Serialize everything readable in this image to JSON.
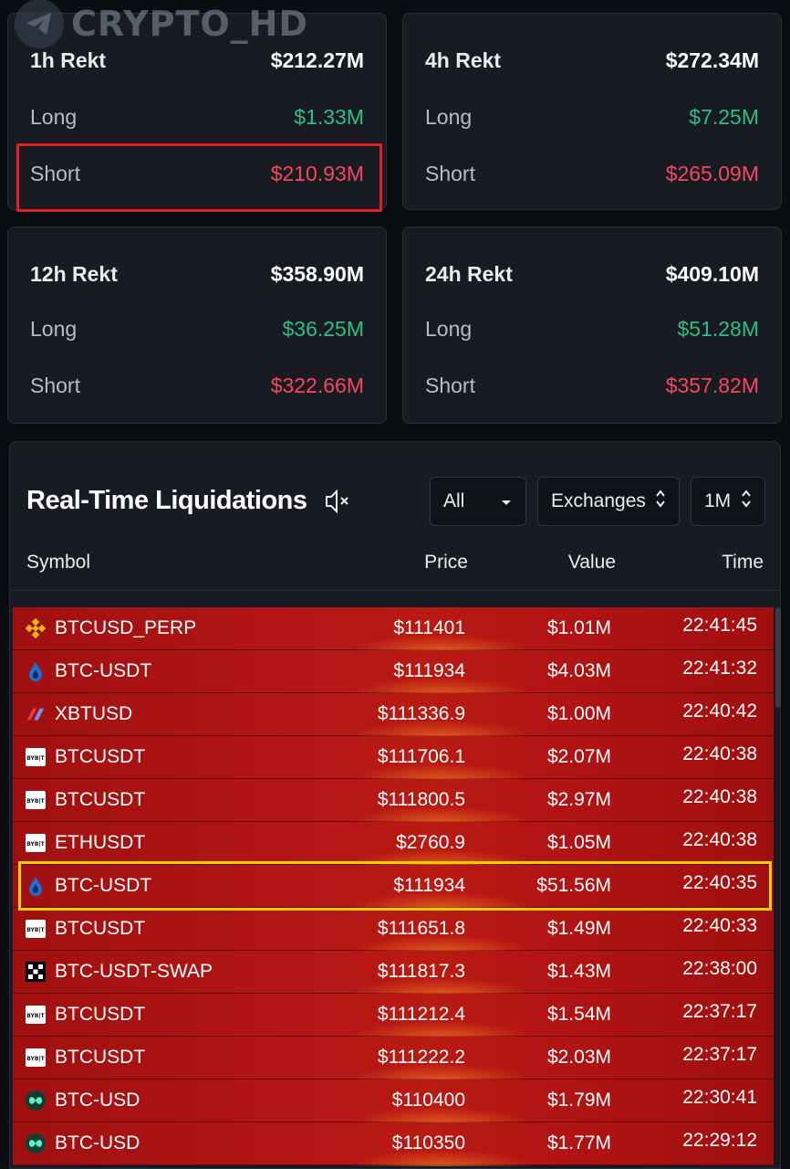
{
  "watermark": {
    "text": "CRYPTO_HD",
    "icon": "telegram-icon"
  },
  "cards": [
    {
      "title": "1h Rekt",
      "total": "$212.27M",
      "long_label": "Long",
      "long": "$1.33M",
      "short_label": "Short",
      "short": "$210.93M"
    },
    {
      "title": "4h Rekt",
      "total": "$272.34M",
      "long_label": "Long",
      "long": "$7.25M",
      "short_label": "Short",
      "short": "$265.09M"
    },
    {
      "title": "12h Rekt",
      "total": "$358.90M",
      "long_label": "Long",
      "long": "$36.25M",
      "short_label": "Short",
      "short": "$322.66M"
    },
    {
      "title": "24h Rekt",
      "total": "$409.10M",
      "long_label": "Long",
      "long": "$51.28M",
      "short_label": "Short",
      "short": "$357.82M"
    }
  ],
  "panel": {
    "title": "Real-Time Liquidations",
    "filter_all": "All",
    "filter_exchanges": "Exchanges",
    "filter_amount": "1M",
    "columns": {
      "symbol": "Symbol",
      "price": "Price",
      "value": "Value",
      "time": "Time"
    }
  },
  "liquidations": [
    {
      "icon": "binance-icon",
      "symbol": "BTCUSD_PERP",
      "price": "$111401",
      "value": "$1.01M",
      "time": "22:41:45"
    },
    {
      "icon": "hyperliquid-icon",
      "symbol": "BTC-USDT",
      "price": "$111934",
      "value": "$4.03M",
      "time": "22:41:32"
    },
    {
      "icon": "bitmex-icon",
      "symbol": "XBTUSD",
      "price": "$111336.9",
      "value": "$1.00M",
      "time": "22:40:42"
    },
    {
      "icon": "bybit-icon",
      "symbol": "BTCUSDT",
      "price": "$111706.1",
      "value": "$2.07M",
      "time": "22:40:38"
    },
    {
      "icon": "bybit-icon",
      "symbol": "BTCUSDT",
      "price": "$111800.5",
      "value": "$2.97M",
      "time": "22:40:38"
    },
    {
      "icon": "bybit-icon",
      "symbol": "ETHUSDT",
      "price": "$2760.9",
      "value": "$1.05M",
      "time": "22:40:38"
    },
    {
      "icon": "hyperliquid-icon",
      "symbol": "BTC-USDT",
      "price": "$111934",
      "value": "$51.56M",
      "time": "22:40:35"
    },
    {
      "icon": "bybit-icon",
      "symbol": "BTCUSDT",
      "price": "$111651.8",
      "value": "$1.49M",
      "time": "22:40:33"
    },
    {
      "icon": "okx-icon",
      "symbol": "BTC-USDT-SWAP",
      "price": "$111817.3",
      "value": "$1.43M",
      "time": "22:38:00"
    },
    {
      "icon": "bybit-icon",
      "symbol": "BTCUSDT",
      "price": "$111212.4",
      "value": "$1.54M",
      "time": "22:37:17"
    },
    {
      "icon": "bybit-icon",
      "symbol": "BTCUSDT",
      "price": "$111222.2",
      "value": "$2.03M",
      "time": "22:37:17"
    },
    {
      "icon": "hyperliquid-mint-icon",
      "symbol": "BTC-USD",
      "price": "$110400",
      "value": "$1.79M",
      "time": "22:30:41"
    },
    {
      "icon": "hyperliquid-mint-icon",
      "symbol": "BTC-USD",
      "price": "$110350",
      "value": "$1.77M",
      "time": "22:29:12"
    }
  ],
  "colors": {
    "long": "#2ebd85",
    "short": "#f6465d",
    "row_bg": "#b31414",
    "highlight_red": "#e41e26",
    "highlight_yellow": "#f3d000"
  }
}
